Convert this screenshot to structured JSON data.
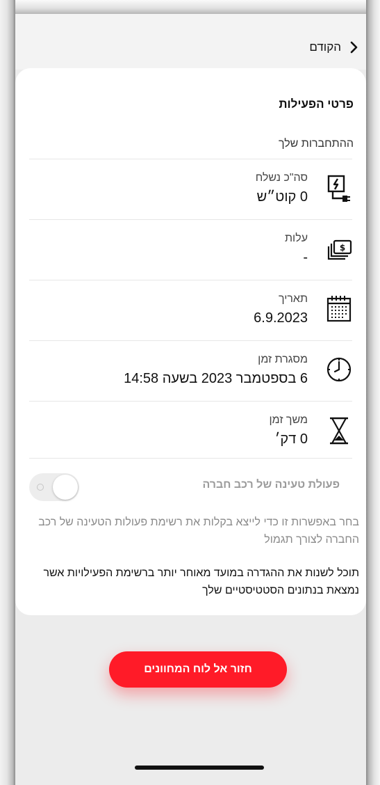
{
  "nav": {
    "back_label": "הקודם"
  },
  "details": {
    "title": "פרטי הפעילות",
    "subtitle": "ההתחברות שלך",
    "rows": [
      {
        "icon": "charger-plug-icon",
        "label": "סה\"כ נשלח",
        "value": "0 קוט״ש"
      },
      {
        "icon": "money-bills-icon",
        "label": "עלות",
        "value": "-"
      },
      {
        "icon": "calendar-icon",
        "label": "תאריך",
        "value": "6.9.2023"
      },
      {
        "icon": "clock-icon",
        "label": "מסגרת זמן",
        "value": "6 בספטמבר 2023 בשעה 14:58"
      },
      {
        "icon": "hourglass-icon",
        "label": "משך זמן",
        "value": "0 דק׳"
      }
    ]
  },
  "company_car": {
    "label": "פעולת טעינה של רכב חברה",
    "toggle_on": false,
    "help": "בחר באפשרות זו כדי לייצא בקלות את רשימת פעולות הטעינה של רכב החברה לצורך תגמול",
    "note": "תוכל לשנות את ההגדרה במועד מאוחר יותר ברשימת הפעילויות אשר נמצאת בנתונים הסטטיסטיים שלך"
  },
  "cta": {
    "label": "חזור אל לוח המחוונים"
  },
  "colors": {
    "accent": "#ff1b28",
    "background": "#ececec",
    "card": "#ffffff"
  }
}
